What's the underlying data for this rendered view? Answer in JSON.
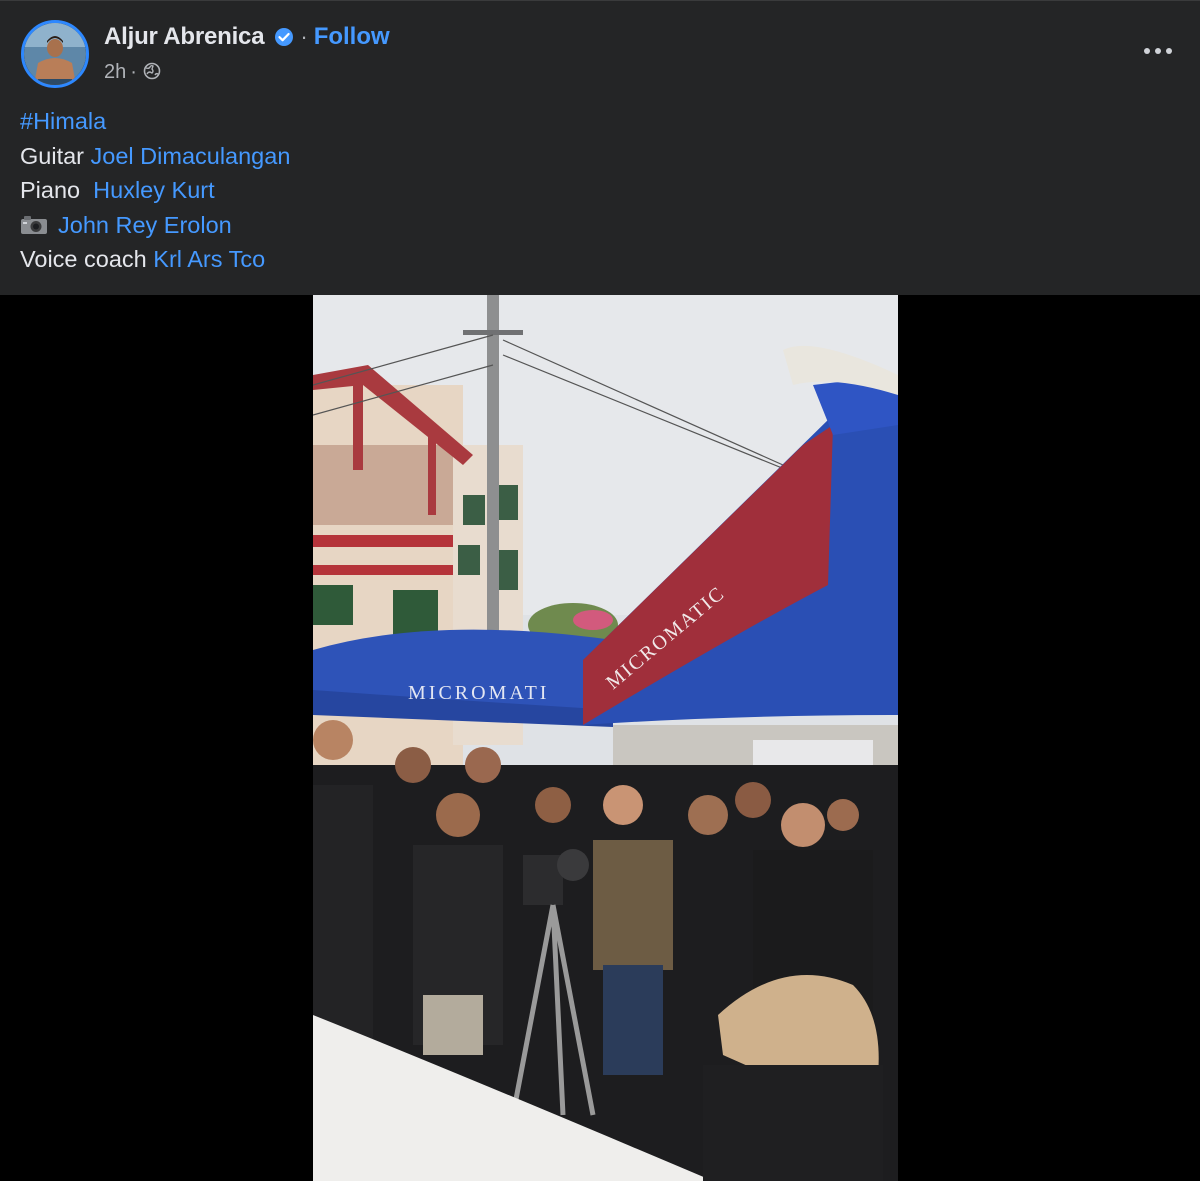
{
  "post": {
    "author": {
      "name": "Aljur Abrenica",
      "verified_icon": "verified-badge-icon",
      "follow_label": "Follow",
      "separator": "·"
    },
    "time": "2h",
    "time_separator": "·",
    "audience_icon": "globe-icon",
    "more_icon": "more-options-icon",
    "caption": {
      "hashtag": "#Himala",
      "credits": [
        {
          "role": "Guitar ",
          "person": "Joel Dimaculangan"
        },
        {
          "role": "Piano  ",
          "person": "Huxley Kurt"
        },
        {
          "role_icon": "camera-icon",
          "person": "John Rey Erolon"
        },
        {
          "role": "Voice coach ",
          "person": "Krl Ars Tco"
        }
      ]
    },
    "photo": {
      "umbrella_left_text": "MICROMATI",
      "umbrella_right_text": "MICROMATIC"
    }
  },
  "colors": {
    "background": "#242526",
    "link": "#4599ff",
    "text": "#e4e6eb",
    "muted": "#b0b3b8"
  }
}
